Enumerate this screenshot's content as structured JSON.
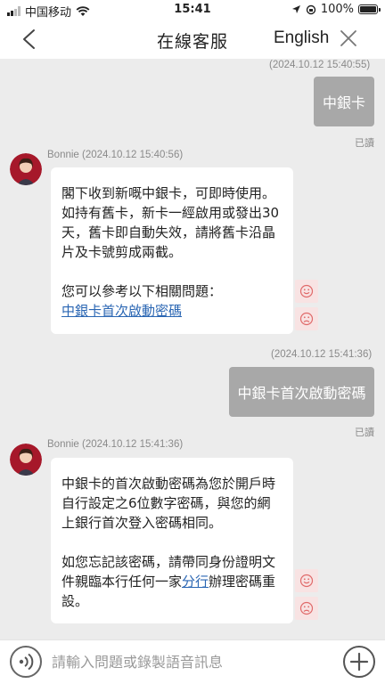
{
  "status_bar": {
    "carrier": "中国移动",
    "time": "15:41",
    "battery": "100%",
    "battery_level": 1.0
  },
  "header": {
    "title": "在線客服",
    "language_label": "English",
    "icons": {
      "back": "chevron-left-icon",
      "close": "close-icon"
    }
  },
  "messages": [
    {
      "type": "user",
      "timestamp": "(2024.10.12 15:40:55)",
      "text": "中銀卡",
      "status": "已讀"
    },
    {
      "type": "bot",
      "sender": "Bonnie (2024.10.12 15:40:56)",
      "para1": "閣下收到新嘅中銀卡，可即時使用。如持有舊卡，新卡一經啟用或發出30天，舊卡即自動失效，請將舊卡沿晶片及卡號剪成兩截。",
      "para2": "您可以參考以下相關問題：",
      "link": "中銀卡首次啟動密碼"
    },
    {
      "type": "user",
      "timestamp": "(2024.10.12 15:41:36)",
      "text": "中銀卡首次啟動密碼",
      "status": "已讀"
    },
    {
      "type": "bot",
      "sender": "Bonnie (2024.10.12 15:41:36)",
      "para1": "中銀卡的首次啟動密碼為您於開戶時自行設定之6位數字密碼，與您的網上銀行首次登入密碼相同。",
      "para2_before": "如您忘記該密碼，請帶同身份證明文件親臨本行任何一家",
      "para2_link": "分行",
      "para2_after": "辦理密碼重設。"
    }
  ],
  "input_bar": {
    "placeholder": "請輸入問題或錄製語音訊息",
    "icons": {
      "voice": "voice-icon",
      "add": "plus-icon"
    }
  },
  "colors": {
    "chat_background": "#ececec",
    "user_bubble": "#a8a8a8",
    "link": "#2a66b3",
    "rating_button_bg": "#f8e3e3",
    "rating_icon": "#e06a6a"
  }
}
